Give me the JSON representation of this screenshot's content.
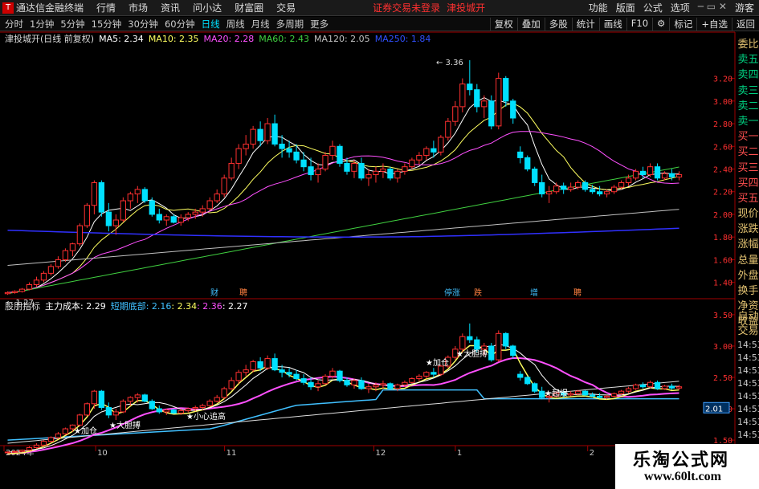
{
  "topbar": {
    "app_title": "通达信金融终端",
    "menus": [
      "行情",
      "市场",
      "资讯",
      "问小达",
      "财富圈",
      "交易"
    ],
    "notice": "证券交易未登录",
    "stock_name": "津投城开",
    "right_menus": [
      "功能",
      "版面",
      "公式",
      "选项"
    ],
    "guest": "游客"
  },
  "timeframes": {
    "items": [
      "分时",
      "1分钟",
      "5分钟",
      "15分钟",
      "30分钟",
      "60分钟",
      "日线",
      "周线",
      "月线",
      "多周期",
      "更多"
    ],
    "active": "日线",
    "right_tools": [
      "复权",
      "叠加",
      "多股",
      "统计",
      "画线",
      "F10",
      "标记",
      "+自选",
      "返回"
    ]
  },
  "main_info": {
    "title": "津投城开(日线 前复权)",
    "ma5": "MA5: 2.34",
    "ma10": "MA10: 2.35",
    "ma20": "MA20: 2.28",
    "ma60": "MA60: 2.43",
    "ma120": "MA120: 2.05",
    "ma250": "MA250: 1.84"
  },
  "indicator_info": {
    "name": "股朋指标",
    "cost": "主力成本: 2.29",
    "short_bottom": "短期底部: 2.16",
    "v1": ": 2.34",
    "v2": ": 2.36",
    "v3": ": 2.27"
  },
  "side_labels": [
    "委比",
    "卖五",
    "卖四",
    "卖三",
    "卖二",
    "卖一",
    "买一",
    "买二",
    "买三",
    "买四",
    "买五",
    "现价",
    "涨跌",
    "涨幅",
    "总量",
    "外盘",
    "换手",
    "净资",
    "收益"
  ],
  "side2_labels": [
    "自动",
    "交易",
    "14:53",
    "14:53",
    "14:53",
    "14:53",
    "14:53",
    "14:53",
    "14:53",
    "14:53",
    "14:53"
  ],
  "price_axis": [
    "3.20",
    "3.00",
    "2.80",
    "2.60",
    "2.40",
    "2.20",
    "2.00",
    "1.80",
    "1.60",
    "1.40"
  ],
  "ind_axis": [
    "3.50",
    "3.00",
    "2.50",
    "2.00",
    "1.50"
  ],
  "price_marker": "2.01",
  "dates": [
    "2024年",
    "10",
    "11",
    "12",
    "1",
    "2"
  ],
  "annotations": {
    "high": "3.36",
    "low": "1.27",
    "events": [
      "财",
      "聘",
      "停涨",
      "跌",
      "增",
      "聘"
    ],
    "ind_labels": [
      "加仓",
      "大胆搏",
      "小心追高",
      "加仓",
      "大胆搏",
      "起爆"
    ]
  },
  "watermark": {
    "line1": "乐淘公式网",
    "line2": "www.60lt.com"
  },
  "colors": {
    "up": "#ff3030",
    "down": "#00e0ff",
    "ma5": "#ffffff",
    "ma10": "#ffff60",
    "ma20": "#ff50ff",
    "ma60": "#40d040",
    "ma120": "#c0c0c0",
    "ma250": "#3030ff"
  },
  "chart_data": {
    "type": "line",
    "title": "津投城开(日线 前复权)",
    "ylim": [
      1.27,
      3.36
    ],
    "candles": [
      [
        1.3,
        1.32,
        1.29,
        1.31
      ],
      [
        1.31,
        1.33,
        1.3,
        1.32
      ],
      [
        1.32,
        1.35,
        1.31,
        1.34
      ],
      [
        1.34,
        1.4,
        1.33,
        1.38
      ],
      [
        1.38,
        1.45,
        1.36,
        1.42
      ],
      [
        1.42,
        1.5,
        1.4,
        1.48
      ],
      [
        1.48,
        1.56,
        1.46,
        1.54
      ],
      [
        1.54,
        1.63,
        1.52,
        1.6
      ],
      [
        1.6,
        1.7,
        1.58,
        1.68
      ],
      [
        1.68,
        1.75,
        1.63,
        1.74
      ],
      [
        1.74,
        1.92,
        1.72,
        1.9
      ],
      [
        1.9,
        2.1,
        1.88,
        2.08
      ],
      [
        2.08,
        2.3,
        2.0,
        2.28
      ],
      [
        2.28,
        2.3,
        1.98,
        2.02
      ],
      [
        2.02,
        2.1,
        1.85,
        1.9
      ],
      [
        1.9,
        2.0,
        1.82,
        1.95
      ],
      [
        1.95,
        2.15,
        1.93,
        2.12
      ],
      [
        2.12,
        2.2,
        2.05,
        2.18
      ],
      [
        2.18,
        2.25,
        2.1,
        2.22
      ],
      [
        2.22,
        2.24,
        2.1,
        2.12
      ],
      [
        2.12,
        2.15,
        1.98,
        2.0
      ],
      [
        2.0,
        2.05,
        1.92,
        1.95
      ],
      [
        1.95,
        2.0,
        1.9,
        1.98
      ],
      [
        1.98,
        2.0,
        1.92,
        1.93
      ],
      [
        1.93,
        2.0,
        1.9,
        1.97
      ],
      [
        1.97,
        2.02,
        1.94,
        2.0
      ],
      [
        2.0,
        2.05,
        1.96,
        2.02
      ],
      [
        2.02,
        2.08,
        1.98,
        2.05
      ],
      [
        2.05,
        2.15,
        2.03,
        2.12
      ],
      [
        2.12,
        2.22,
        2.1,
        2.18
      ],
      [
        2.18,
        2.35,
        2.15,
        2.32
      ],
      [
        2.32,
        2.5,
        2.3,
        2.45
      ],
      [
        2.45,
        2.62,
        2.4,
        2.58
      ],
      [
        2.58,
        2.7,
        2.52,
        2.62
      ],
      [
        2.62,
        2.78,
        2.58,
        2.75
      ],
      [
        2.75,
        2.82,
        2.6,
        2.65
      ],
      [
        2.65,
        2.85,
        2.62,
        2.8
      ],
      [
        2.8,
        2.88,
        2.6,
        2.62
      ],
      [
        2.62,
        2.7,
        2.5,
        2.58
      ],
      [
        2.58,
        2.65,
        2.5,
        2.55
      ],
      [
        2.55,
        2.62,
        2.45,
        2.48
      ],
      [
        2.48,
        2.55,
        2.38,
        2.42
      ],
      [
        2.42,
        2.5,
        2.3,
        2.35
      ],
      [
        2.35,
        2.45,
        2.28,
        2.4
      ],
      [
        2.4,
        2.55,
        2.38,
        2.52
      ],
      [
        2.52,
        2.65,
        2.48,
        2.6
      ],
      [
        2.6,
        2.62,
        2.42,
        2.45
      ],
      [
        2.45,
        2.5,
        2.35,
        2.38
      ],
      [
        2.38,
        2.48,
        2.32,
        2.45
      ],
      [
        2.45,
        2.5,
        2.3,
        2.32
      ],
      [
        2.32,
        2.4,
        2.25,
        2.35
      ],
      [
        2.35,
        2.42,
        2.28,
        2.38
      ],
      [
        2.38,
        2.45,
        2.32,
        2.4
      ],
      [
        2.4,
        2.42,
        2.3,
        2.32
      ],
      [
        2.32,
        2.4,
        2.28,
        2.38
      ],
      [
        2.38,
        2.45,
        2.35,
        2.42
      ],
      [
        2.42,
        2.5,
        2.4,
        2.48
      ],
      [
        2.48,
        2.55,
        2.44,
        2.52
      ],
      [
        2.52,
        2.6,
        2.48,
        2.58
      ],
      [
        2.58,
        2.65,
        2.5,
        2.55
      ],
      [
        2.55,
        2.7,
        2.52,
        2.68
      ],
      [
        2.68,
        2.85,
        2.65,
        2.82
      ],
      [
        2.82,
        3.0,
        2.78,
        2.95
      ],
      [
        2.95,
        3.2,
        2.9,
        3.15
      ],
      [
        3.15,
        3.36,
        3.05,
        3.1
      ],
      [
        3.1,
        3.15,
        2.9,
        2.95
      ],
      [
        2.95,
        3.05,
        2.85,
        3.0
      ],
      [
        3.0,
        3.05,
        2.75,
        2.78
      ],
      [
        2.78,
        3.25,
        2.75,
        3.2
      ],
      [
        3.2,
        3.22,
        2.95,
        3.0
      ],
      [
        3.0,
        3.02,
        2.8,
        2.85
      ],
      [
        2.55,
        2.6,
        2.45,
        2.5
      ],
      [
        2.5,
        2.52,
        2.38,
        2.4
      ],
      [
        2.4,
        2.42,
        2.25,
        2.28
      ],
      [
        2.28,
        2.35,
        2.15,
        2.18
      ],
      [
        2.18,
        2.25,
        2.1,
        2.2
      ],
      [
        2.2,
        2.28,
        2.18,
        2.25
      ],
      [
        2.25,
        2.28,
        2.18,
        2.22
      ],
      [
        2.22,
        2.28,
        2.2,
        2.24
      ],
      [
        2.24,
        2.3,
        2.22,
        2.28
      ],
      [
        2.28,
        2.3,
        2.2,
        2.22
      ],
      [
        2.22,
        2.26,
        2.18,
        2.2
      ],
      [
        2.2,
        2.25,
        2.16,
        2.18
      ],
      [
        2.18,
        2.22,
        2.15,
        2.2
      ],
      [
        2.2,
        2.26,
        2.18,
        2.24
      ],
      [
        2.24,
        2.3,
        2.22,
        2.28
      ],
      [
        2.28,
        2.35,
        2.25,
        2.32
      ],
      [
        2.32,
        2.4,
        2.3,
        2.38
      ],
      [
        2.38,
        2.42,
        2.32,
        2.35
      ],
      [
        2.35,
        2.45,
        2.33,
        2.42
      ],
      [
        2.42,
        2.45,
        2.3,
        2.32
      ],
      [
        2.32,
        2.38,
        2.3,
        2.36
      ],
      [
        2.36,
        2.4,
        2.3,
        2.33
      ],
      [
        2.33,
        2.38,
        2.3,
        2.35
      ]
    ]
  }
}
